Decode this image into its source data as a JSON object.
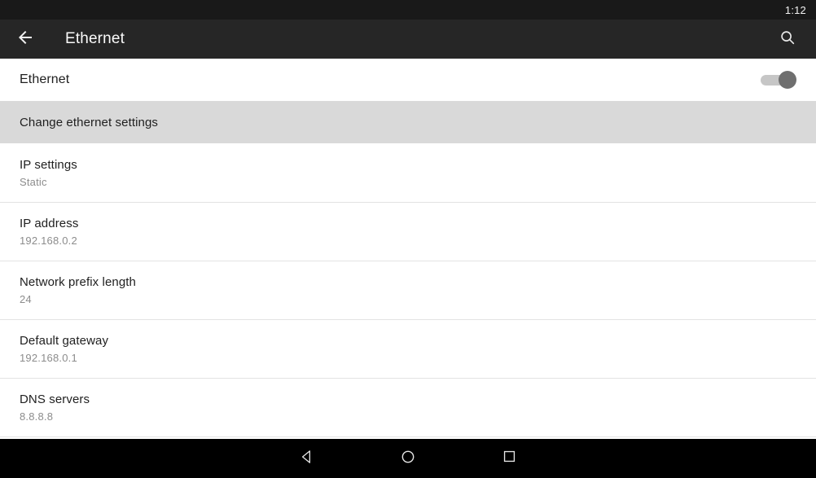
{
  "status_bar": {
    "clock": "1:12"
  },
  "toolbar": {
    "back_icon": "arrow-back-icon",
    "title": "Ethernet",
    "search_icon": "search-icon"
  },
  "ethernet_toggle": {
    "label": "Ethernet",
    "state": "on"
  },
  "section_header": {
    "label": "Change ethernet settings"
  },
  "preferences": [
    {
      "title": "IP settings",
      "summary": "Static"
    },
    {
      "title": "IP address",
      "summary": "192.168.0.2"
    },
    {
      "title": "Network prefix length",
      "summary": "24"
    },
    {
      "title": "Default gateway",
      "summary": "192.168.0.1"
    },
    {
      "title": "DNS servers",
      "summary": "8.8.8.8"
    }
  ],
  "nav_bar": {
    "back": "nav-back-icon",
    "home": "nav-home-icon",
    "recents": "nav-recents-icon"
  },
  "colors": {
    "status_bar_bg": "#191919",
    "toolbar_bg": "#262626",
    "section_header_bg": "#d9d9d9",
    "divider": "#e3e3e3",
    "switch_track": "#c6c6c6",
    "switch_thumb": "#6f6f6f",
    "nav_bar_bg": "#000000"
  }
}
